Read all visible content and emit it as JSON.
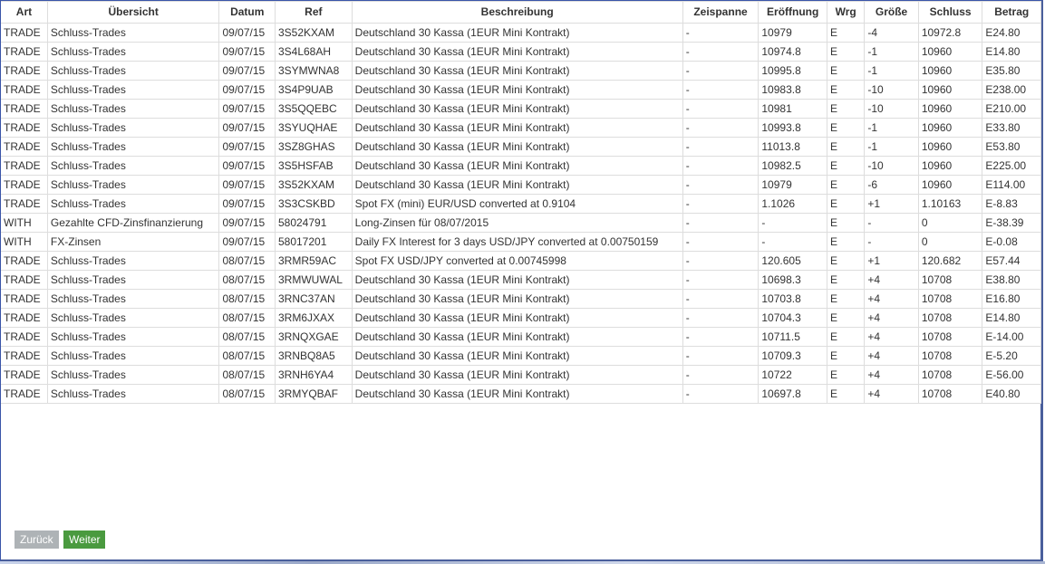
{
  "table": {
    "columns": [
      "Art",
      "Übersicht",
      "Datum",
      "Ref",
      "Beschreibung",
      "Zeispanne",
      "Eröffnung",
      "Wrg",
      "Größe",
      "Schluss",
      "Betrag"
    ],
    "rows": [
      [
        "TRADE",
        "Schluss-Trades",
        "09/07/15",
        "3S52KXAM",
        "Deutschland 30 Kassa (1EUR Mini Kontrakt)",
        "-",
        "10979",
        "E",
        "-4",
        "10972.8",
        "E24.80"
      ],
      [
        "TRADE",
        "Schluss-Trades",
        "09/07/15",
        "3S4L68AH",
        "Deutschland 30 Kassa (1EUR Mini Kontrakt)",
        "-",
        "10974.8",
        "E",
        "-1",
        "10960",
        "E14.80"
      ],
      [
        "TRADE",
        "Schluss-Trades",
        "09/07/15",
        "3SYMWNA8",
        "Deutschland 30 Kassa (1EUR Mini Kontrakt)",
        "-",
        "10995.8",
        "E",
        "-1",
        "10960",
        "E35.80"
      ],
      [
        "TRADE",
        "Schluss-Trades",
        "09/07/15",
        "3S4P9UAB",
        "Deutschland 30 Kassa (1EUR Mini Kontrakt)",
        "-",
        "10983.8",
        "E",
        "-10",
        "10960",
        "E238.00"
      ],
      [
        "TRADE",
        "Schluss-Trades",
        "09/07/15",
        "3S5QQEBC",
        "Deutschland 30 Kassa (1EUR Mini Kontrakt)",
        "-",
        "10981",
        "E",
        "-10",
        "10960",
        "E210.00"
      ],
      [
        "TRADE",
        "Schluss-Trades",
        "09/07/15",
        "3SYUQHAE",
        "Deutschland 30 Kassa (1EUR Mini Kontrakt)",
        "-",
        "10993.8",
        "E",
        "-1",
        "10960",
        "E33.80"
      ],
      [
        "TRADE",
        "Schluss-Trades",
        "09/07/15",
        "3SZ8GHAS",
        "Deutschland 30 Kassa (1EUR Mini Kontrakt)",
        "-",
        "11013.8",
        "E",
        "-1",
        "10960",
        "E53.80"
      ],
      [
        "TRADE",
        "Schluss-Trades",
        "09/07/15",
        "3S5HSFAB",
        "Deutschland 30 Kassa (1EUR Mini Kontrakt)",
        "-",
        "10982.5",
        "E",
        "-10",
        "10960",
        "E225.00"
      ],
      [
        "TRADE",
        "Schluss-Trades",
        "09/07/15",
        "3S52KXAM",
        "Deutschland 30 Kassa (1EUR Mini Kontrakt)",
        "-",
        "10979",
        "E",
        "-6",
        "10960",
        "E114.00"
      ],
      [
        "TRADE",
        "Schluss-Trades",
        "09/07/15",
        "3S3CSKBD",
        "Spot FX (mini) EUR/USD converted at 0.9104",
        "-",
        "1.1026",
        "E",
        "+1",
        "1.10163",
        "E-8.83"
      ],
      [
        "WITH",
        "Gezahlte CFD-Zinsfinanzierung",
        "09/07/15",
        "58024791",
        "Long-Zinsen für 08/07/2015",
        "-",
        "-",
        "E",
        "-",
        "0",
        "E-38.39"
      ],
      [
        "WITH",
        "FX-Zinsen",
        "09/07/15",
        "58017201",
        "Daily FX Interest for 3 days USD/JPY converted at 0.00750159",
        "-",
        "-",
        "E",
        "-",
        "0",
        "E-0.08"
      ],
      [
        "TRADE",
        "Schluss-Trades",
        "08/07/15",
        "3RMR59AC",
        "Spot FX USD/JPY converted at 0.00745998",
        "-",
        "120.605",
        "E",
        "+1",
        "120.682",
        "E57.44"
      ],
      [
        "TRADE",
        "Schluss-Trades",
        "08/07/15",
        "3RMWUWAL",
        "Deutschland 30 Kassa (1EUR Mini Kontrakt)",
        "-",
        "10698.3",
        "E",
        "+4",
        "10708",
        "E38.80"
      ],
      [
        "TRADE",
        "Schluss-Trades",
        "08/07/15",
        "3RNC37AN",
        "Deutschland 30 Kassa (1EUR Mini Kontrakt)",
        "-",
        "10703.8",
        "E",
        "+4",
        "10708",
        "E16.80"
      ],
      [
        "TRADE",
        "Schluss-Trades",
        "08/07/15",
        "3RM6JXAX",
        "Deutschland 30 Kassa (1EUR Mini Kontrakt)",
        "-",
        "10704.3",
        "E",
        "+4",
        "10708",
        "E14.80"
      ],
      [
        "TRADE",
        "Schluss-Trades",
        "08/07/15",
        "3RNQXGAE",
        "Deutschland 30 Kassa (1EUR Mini Kontrakt)",
        "-",
        "10711.5",
        "E",
        "+4",
        "10708",
        "E-14.00"
      ],
      [
        "TRADE",
        "Schluss-Trades",
        "08/07/15",
        "3RNBQ8A5",
        "Deutschland 30 Kassa (1EUR Mini Kontrakt)",
        "-",
        "10709.3",
        "E",
        "+4",
        "10708",
        "E-5.20"
      ],
      [
        "TRADE",
        "Schluss-Trades",
        "08/07/15",
        "3RNH6YA4",
        "Deutschland 30 Kassa (1EUR Mini Kontrakt)",
        "-",
        "10722",
        "E",
        "+4",
        "10708",
        "E-56.00"
      ],
      [
        "TRADE",
        "Schluss-Trades",
        "08/07/15",
        "3RMYQBAF",
        "Deutschland 30 Kassa (1EUR Mini Kontrakt)",
        "-",
        "10697.8",
        "E",
        "+4",
        "10708",
        "E40.80"
      ]
    ]
  },
  "pagination": {
    "back_label": "Zurück",
    "next_label": "Weiter"
  },
  "colors": {
    "frame_border": "#3a55a8",
    "grid_line": "#dddddd",
    "back_button": "#aeb3b6",
    "next_button": "#4a9a3f",
    "text": "#333333"
  }
}
